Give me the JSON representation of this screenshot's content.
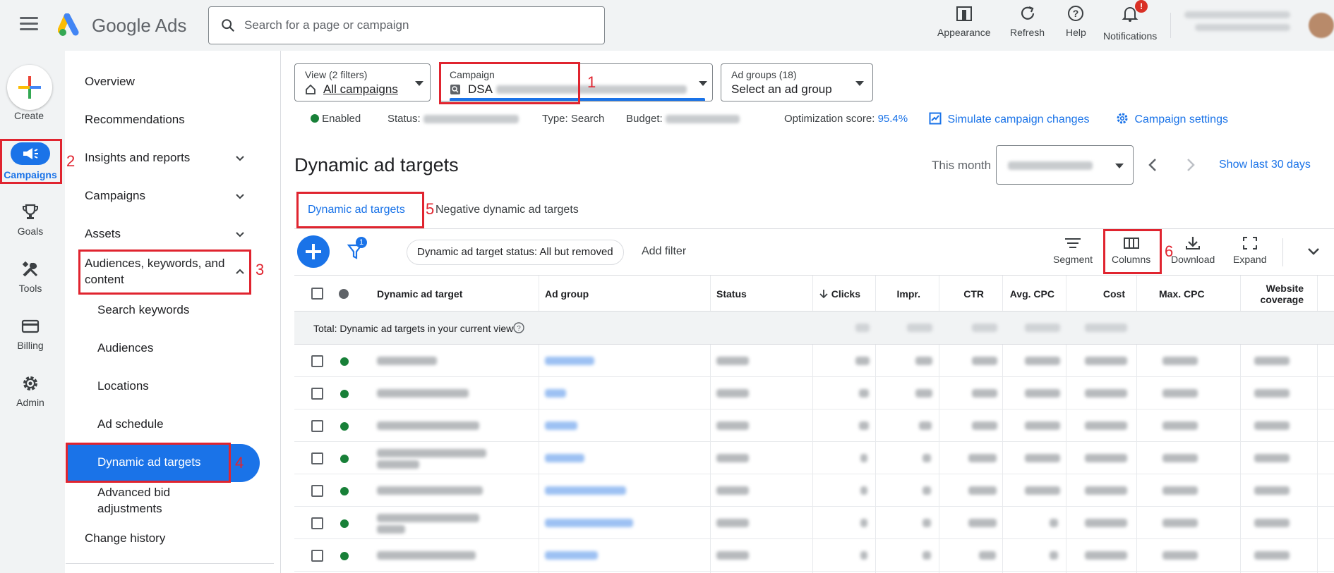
{
  "topbar": {
    "app_name": "Google Ads",
    "search_placeholder": "Search for a page or campaign",
    "actions": [
      {
        "label": "Appearance",
        "icon": "appearance-icon"
      },
      {
        "label": "Refresh",
        "icon": "refresh-icon"
      },
      {
        "label": "Help",
        "icon": "help-icon"
      },
      {
        "label": "Notifications",
        "icon": "bell-icon"
      }
    ],
    "notification_badge": "!"
  },
  "rail": {
    "create": "Create",
    "items": [
      {
        "label": "Campaigns",
        "icon": "campaigns-icon"
      },
      {
        "label": "Goals",
        "icon": "trophy-icon"
      },
      {
        "label": "Tools",
        "icon": "tools-icon"
      },
      {
        "label": "Billing",
        "icon": "card-icon"
      },
      {
        "label": "Admin",
        "icon": "gear-icon"
      }
    ]
  },
  "nav": {
    "overview": "Overview",
    "recommendations": "Recommendations",
    "insights": "Insights and reports",
    "campaigns": "Campaigns",
    "assets": "Assets",
    "audiences_line1": "Audiences, keywords, and",
    "audiences_line2": "content",
    "sub": {
      "search_keywords": "Search keywords",
      "audiences": "Audiences",
      "locations": "Locations",
      "ad_schedule": "Ad schedule",
      "dynamic_ad_targets": "Dynamic ad targets",
      "advanced_bid_line1": "Advanced bid",
      "advanced_bid_line2": "adjustments"
    },
    "change_history": "Change history"
  },
  "annotations": [
    "1",
    "2",
    "3",
    "4",
    "5",
    "6"
  ],
  "filters": {
    "view_label": "View (2 filters)",
    "view_value": "All campaigns",
    "campaign_label": "Campaign",
    "campaign_value": "DSA",
    "adgroups_label": "Ad groups (18)",
    "adgroups_value": "Select an ad group"
  },
  "status": {
    "enabled": "Enabled",
    "status_label": "Status:",
    "type": "Type: Search",
    "budget_label": "Budget:",
    "opt_label": "Optimization score:",
    "opt_value": "95.4%",
    "simulate": "Simulate campaign changes",
    "settings": "Campaign settings"
  },
  "page": {
    "title": "Dynamic ad targets",
    "date_label": "This month",
    "show_last": "Show last 30 days"
  },
  "tabs": [
    "Dynamic ad targets",
    "Negative dynamic ad targets"
  ],
  "toolbar": {
    "filter_badge": "1",
    "chip": "Dynamic ad target status: All but removed",
    "add_filter": "Add filter",
    "segment": "Segment",
    "columns": "Columns",
    "download": "Download",
    "expand": "Expand"
  },
  "table": {
    "headers": [
      "Dynamic ad target",
      "Ad group",
      "Status",
      "Clicks",
      "Impr.",
      "CTR",
      "Avg. CPC",
      "Cost",
      "Max. CPC",
      "Website",
      "coverage"
    ],
    "total_label": "Total: Dynamic ad targets in your current view"
  },
  "colors": {
    "accent": "#1a73e8",
    "annotation": "#e0242f",
    "enabled_green": "#188038"
  }
}
